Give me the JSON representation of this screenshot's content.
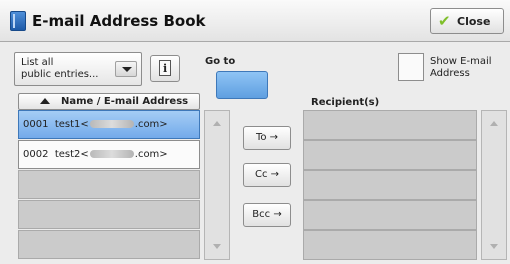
{
  "window": {
    "title": "E-mail Address Book"
  },
  "header": {
    "close_label": "Close"
  },
  "controls": {
    "list_filter": "List all\npublic entries...",
    "info_button_glyph": "i",
    "goto_label": "Go to",
    "show_email_label": "Show E-mail\nAddress"
  },
  "address_list": {
    "column_header": "Name / E-mail Address",
    "entries": [
      {
        "number": "0001",
        "name": "test1<",
        "domain_suffix": ".com>"
      },
      {
        "number": "0002",
        "name": "test2<",
        "domain_suffix": ".com>"
      }
    ]
  },
  "actions": {
    "to_label": "To →",
    "cc_label": "Cc →",
    "bcc_label": "Bcc →"
  },
  "recipients": {
    "label": "Recipient(s)"
  },
  "icons": {
    "title": "address-book-icon",
    "close": "checkmark-icon",
    "info": "info-icon"
  },
  "colors": {
    "selected_row": "#8fbdf0",
    "goto_button": "#75b0ee",
    "close_check": "#7fbf2a"
  }
}
